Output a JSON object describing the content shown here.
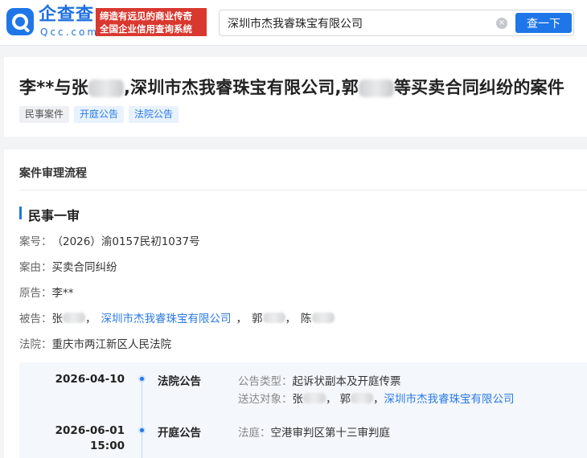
{
  "header": {
    "logo_cn": "企查查",
    "logo_en": "Qcc.com",
    "slogan_line1": "缔造有远见的商业传奇",
    "slogan_line2": "全国企业信用查询系统",
    "search_value": "深圳市杰我睿珠宝有限公司",
    "search_button": "查一下",
    "clear_icon": "×"
  },
  "case": {
    "title_part1": "李**与张",
    "title_part2": ",深圳市杰我睿珠宝有限公司,郭",
    "title_part3": "等买卖合同纠纷的案件",
    "tags": [
      "民事案件",
      "开庭公告",
      "法院公告"
    ]
  },
  "process": {
    "section_title": "案件审理流程",
    "stage_title": "民事一审",
    "case_no_label": "案号：",
    "case_no": "（2026）渝0157民初1037号",
    "cause_label": "案由：",
    "cause": "买卖合同纠纷",
    "plaintiff_label": "原告：",
    "plaintiff": "李**",
    "defendant_label": "被告：",
    "defendant_1": "张",
    "defendant_company": "深圳市杰我睿珠宝有限公司",
    "defendant_3": "郭",
    "defendant_4": "陈",
    "separator": "，",
    "court_label": "法院：",
    "court": "重庆市两江新区人民法院"
  },
  "timeline": [
    {
      "date": "2026-04-10",
      "type": "法院公告",
      "info1_label": "公告类型：",
      "info1_value": "起诉状副本及开庭传票",
      "info2_label": "送达对象：",
      "info2_person1": "张",
      "info2_person2": "郭",
      "info2_company": "深圳市杰我睿珠宝有限公司"
    },
    {
      "date": "2026-06-01",
      "time": "15:00",
      "type": "开庭公告",
      "info1_label": "法庭：",
      "info1_value": "空港审判区第十三审判庭"
    }
  ],
  "colors": {
    "brand": "#1f76e8",
    "slogan_bg": "#d9382f",
    "link": "#2a7be6"
  }
}
